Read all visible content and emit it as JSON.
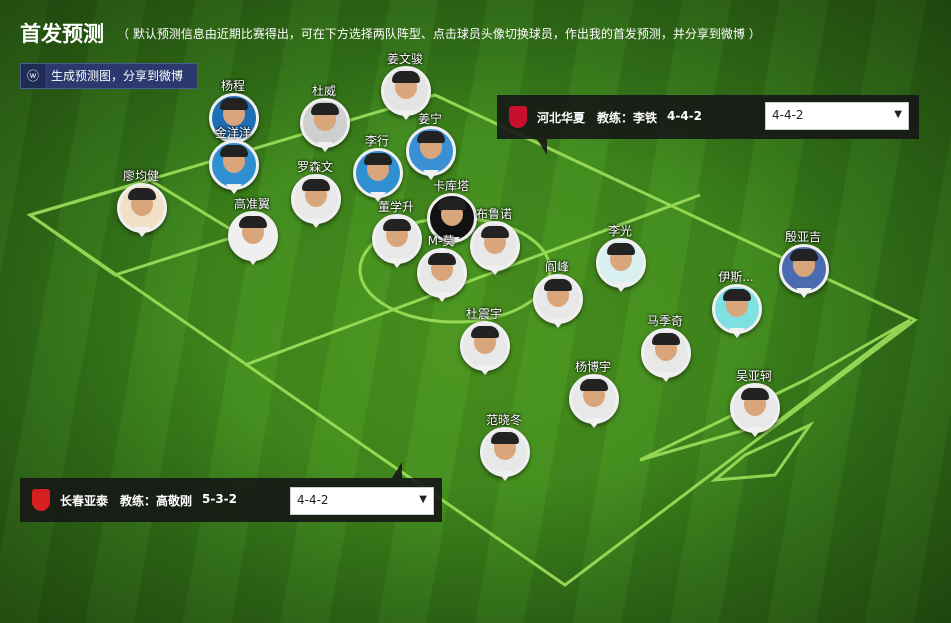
{
  "header": {
    "title": "首发预测",
    "description": "（ 默认预测信息由近期比赛得出，可在下方选择两队阵型、点击球员头像切换球员，作出我的首发预测，并分享到微博 ）"
  },
  "share": {
    "icon": "weibo-icon",
    "label": "生成预测图，分享到微博"
  },
  "team_home": {
    "name": "河北华夏",
    "coach_label": "教练：李铁",
    "formation": "4-4-2",
    "select_value": "4-4-2",
    "badge_color": "#c8102e"
  },
  "team_away": {
    "name": "长春亚泰",
    "coach_label": "教练：高敬刚",
    "formation": "5-3-2",
    "select_value": "4-4-2",
    "badge_color": "#d6201f"
  },
  "home_players": [
    {
      "name": "杨程",
      "color": "#1f6fb5"
    },
    {
      "name": "金洋洋",
      "color": "#2f8fd0"
    },
    {
      "name": "杜威",
      "color": "#cfcfcf"
    },
    {
      "name": "罗森文",
      "color": "#e8e8e8"
    },
    {
      "name": "廖均健",
      "color": "#f0e0c8"
    },
    {
      "name": "高准翼",
      "color": "#efefef"
    },
    {
      "name": "姜文骏",
      "color": "#e4e4e4"
    },
    {
      "name": "李行",
      "color": "#2f8fd0"
    },
    {
      "name": "姜宁",
      "color": "#3a90d5"
    },
    {
      "name": "卡库塔",
      "color": "#111111"
    },
    {
      "name": "董学升",
      "color": "#e8e8e8"
    },
    {
      "name": "M-莫",
      "color": "#e8e8e8"
    }
  ],
  "away_players": [
    {
      "name": "布鲁诺",
      "color": "#e8e8e8"
    },
    {
      "name": "李光",
      "color": "#d9f0f0"
    },
    {
      "name": "殷亚吉",
      "color": "#4a6bb0"
    },
    {
      "name": "阎峰",
      "color": "#e8e8e8"
    },
    {
      "name": "伊斯...",
      "color": "#7ee0e0"
    },
    {
      "name": "杜震宇",
      "color": "#e8e8e8"
    },
    {
      "name": "马季奇",
      "color": "#e8e8e8"
    },
    {
      "name": "杨博宇",
      "color": "#e8e8e8"
    },
    {
      "name": "吴亚轲",
      "color": "#e8e8e8"
    },
    {
      "name": "范晓冬",
      "color": "#e8e8e8"
    }
  ]
}
